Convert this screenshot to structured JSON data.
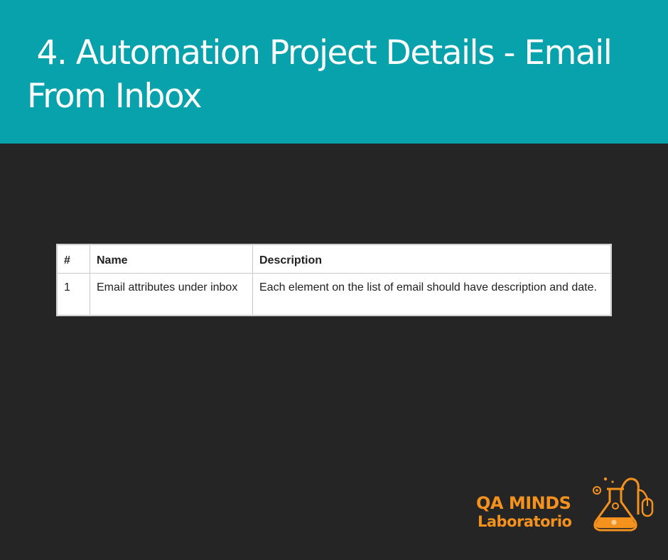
{
  "slide": {
    "title": " 4. Automation Project Details - Email From Inbox"
  },
  "table": {
    "headers": [
      "#",
      "Name",
      "Description"
    ],
    "rows": [
      [
        "1",
        "Email attributes under inbox",
        "Each element on the list of email should have description and date."
      ]
    ]
  },
  "logo": {
    "line1": "QA MINDS",
    "line2": "Laboratorio",
    "icon": "flask-with-gears-and-mouse-icon",
    "color": "#f5921e"
  },
  "colors": {
    "header_bg": "#08a2ad",
    "body_bg": "#252525"
  }
}
